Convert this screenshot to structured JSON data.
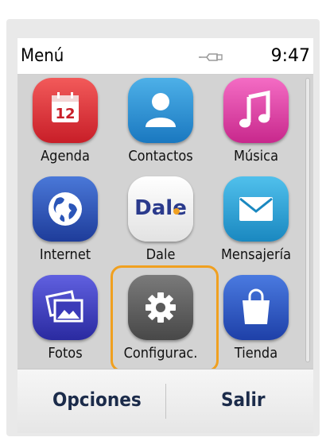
{
  "statusbar": {
    "title": "Menú",
    "clock": "9:47",
    "status_icon": "connection-icon"
  },
  "apps": [
    {
      "label": "Agenda",
      "icon": "calendar-icon",
      "calendar_day": "12",
      "color": "#e0303a"
    },
    {
      "label": "Contactos",
      "icon": "contacts-icon",
      "color": "#2a8fd0"
    },
    {
      "label": "Música",
      "icon": "music-icon",
      "color": "#e040a8"
    },
    {
      "label": "Internet",
      "icon": "globe-icon",
      "color": "#2a55b8"
    },
    {
      "label": "Dale",
      "icon": "dale-logo-icon",
      "icon_text": "Dale",
      "color": "#f0f0f0"
    },
    {
      "label": "Mensajería",
      "icon": "mail-icon",
      "color": "#2aa0d0"
    },
    {
      "label": "Fotos",
      "icon": "photos-icon",
      "color": "#3a3ab8"
    },
    {
      "label": "Configurac.",
      "icon": "gear-icon",
      "color": "#5a5a5a",
      "highlighted": true
    },
    {
      "label": "Tienda",
      "icon": "store-bag-icon",
      "color": "#2a55c8"
    }
  ],
  "softkeys": {
    "left": "Opciones",
    "right": "Salir"
  },
  "colors": {
    "highlight": "#f0a020",
    "softkey_text": "#1b2b4a"
  }
}
